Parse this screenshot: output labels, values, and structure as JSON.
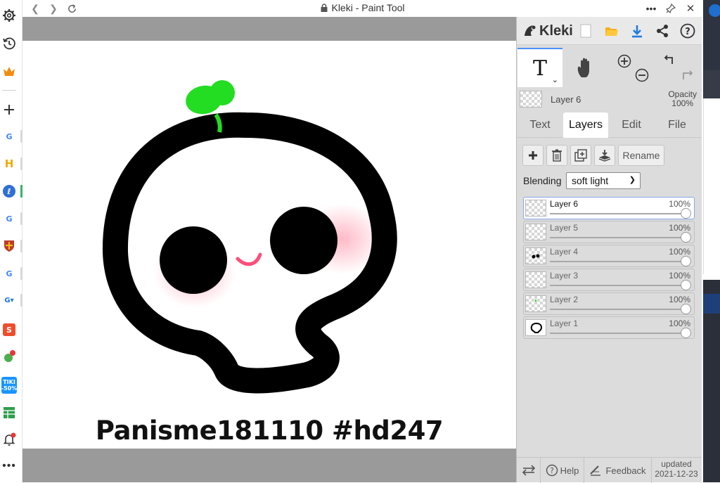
{
  "window": {
    "title": "Kleki - Paint Tool"
  },
  "canvas": {
    "signature": "Panisme181110 #hd247"
  },
  "panel": {
    "logo_text": "Kleki",
    "current_layer": {
      "name": "Layer 6",
      "opacity_label": "Opacity",
      "opacity_value": "100%"
    },
    "tabs": [
      "Text",
      "Layers",
      "Edit",
      "File"
    ],
    "active_tab": "Layers",
    "rename_label": "Rename",
    "blending_label": "Blending",
    "blending_value": "soft light",
    "layers": [
      {
        "name": "Layer 6",
        "opacity": "100%",
        "selected": true
      },
      {
        "name": "Layer 5",
        "opacity": "100%",
        "selected": false
      },
      {
        "name": "Layer 4",
        "opacity": "100%",
        "selected": false
      },
      {
        "name": "Layer 3",
        "opacity": "100%",
        "selected": false
      },
      {
        "name": "Layer 2",
        "opacity": "100%",
        "selected": false
      },
      {
        "name": "Layer 1",
        "opacity": "100%",
        "selected": false
      }
    ],
    "footer": {
      "help": "Help",
      "feedback": "Feedback",
      "updated_label": "updated",
      "updated_date": "2021-12-23"
    }
  },
  "sidebar_icons": [
    "settings-icon",
    "history-icon",
    "crown-icon",
    "add-icon",
    "google-icon",
    "h-icon",
    "kleki-icon",
    "google-icon",
    "shield-icon",
    "google-icon",
    "translate-icon",
    "shopee-icon",
    "bug-icon",
    "tiki-icon",
    "sheets-icon",
    "bell-icon",
    "more-icon"
  ],
  "sidebar_tiki_badge": "-50%",
  "colors": {
    "accent": "#4d90fe",
    "panel_bg": "#dcdcdc",
    "canvas_bg": "#9a9a9a",
    "sprout": "#22dd22",
    "blush": "#ffc8d2",
    "mouth": "#ff4d7a"
  }
}
